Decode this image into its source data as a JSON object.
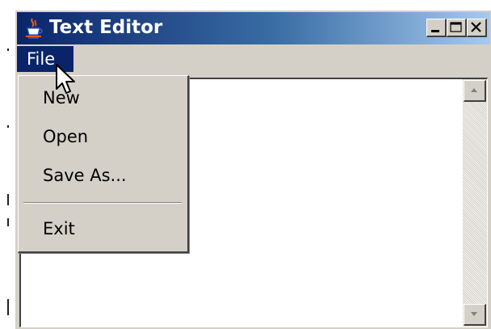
{
  "window": {
    "title": "Text Editor",
    "app_icon": "java-cup-icon",
    "controls": [
      "minimize-icon",
      "maximize-icon",
      "close-icon"
    ]
  },
  "menubar": {
    "items": [
      {
        "label": "File",
        "state": "open"
      }
    ]
  },
  "file_menu": {
    "items": [
      {
        "label": "New"
      },
      {
        "label": "Open"
      },
      {
        "label": "Save As..."
      },
      {
        "label": "Exit"
      }
    ]
  },
  "editor": {
    "content": ""
  },
  "colors": {
    "titlebar_start": "#0a246a",
    "titlebar_end": "#a6caf0",
    "menu_highlight": "#0a246a",
    "chrome": "#d4d0c8"
  }
}
